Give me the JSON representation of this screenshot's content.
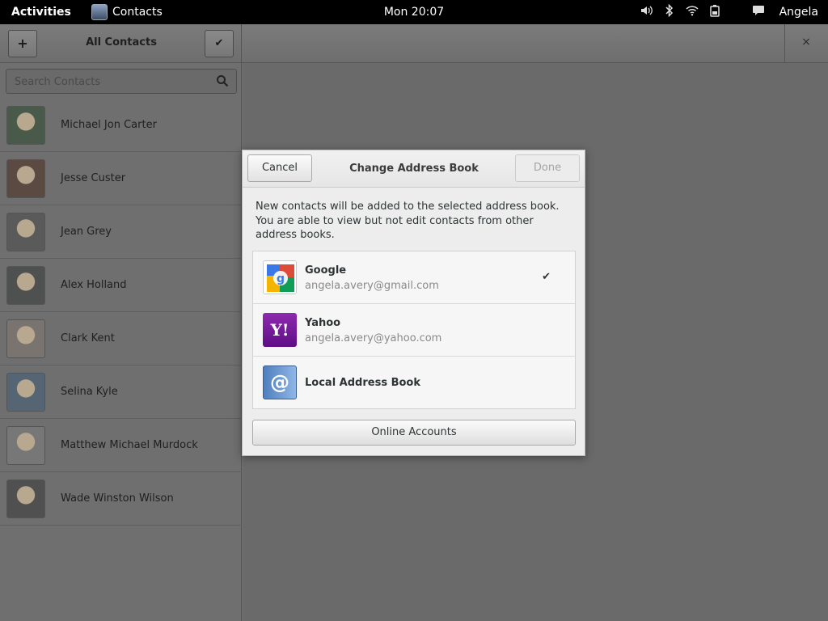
{
  "topbar": {
    "activities": "Activities",
    "app_name": "Contacts",
    "clock": "Mon 20:07",
    "user": "Angela",
    "status_icons": [
      "volume-icon",
      "bluetooth-icon",
      "wifi-icon",
      "battery-icon",
      "chat-icon"
    ]
  },
  "header": {
    "add_label": "+",
    "title": "All Contacts",
    "select_label": "✔",
    "close_label": "×"
  },
  "search": {
    "placeholder": "Search Contacts"
  },
  "contacts": [
    {
      "name": "Michael Jon Carter",
      "avatar_color": "#4a5a4a"
    },
    {
      "name": "Jesse Custer",
      "avatar_color": "#5a4a42"
    },
    {
      "name": "Jean Grey",
      "avatar_color": "#5a5a5a"
    },
    {
      "name": "Alex Holland",
      "avatar_color": "#4f5050"
    },
    {
      "name": "Clark Kent",
      "avatar_color": "#7a7470"
    },
    {
      "name": "Selina Kyle",
      "avatar_color": "#556574"
    },
    {
      "name": "Matthew Michael Murdock",
      "avatar_color": "#777"
    },
    {
      "name": "Wade Winston Wilson",
      "avatar_color": "#505050"
    }
  ],
  "dialog": {
    "cancel_label": "Cancel",
    "title": "Change Address Book",
    "done_label": "Done",
    "description": "New contacts will be added to the selected address book. You are able to view but not edit contacts from other address books.",
    "accounts": [
      {
        "name": "Google",
        "email": "angela.avery@gmail.com",
        "selected": true,
        "icon": "google-icon"
      },
      {
        "name": "Yahoo",
        "email": "angela.avery@yahoo.com",
        "selected": false,
        "icon": "yahoo-icon",
        "icon_text": "Y!"
      },
      {
        "name": "Local Address Book",
        "email": "",
        "selected": false,
        "icon": "address-book-icon",
        "icon_text": "@"
      }
    ],
    "check_mark": "✔",
    "online_accounts_label": "Online Accounts"
  }
}
